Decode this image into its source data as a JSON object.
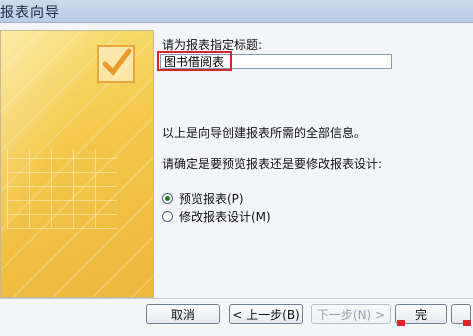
{
  "window": {
    "title": "报表向导"
  },
  "form": {
    "title_prompt": "请为报表指定标题:",
    "title_value": "图书借阅表",
    "info_text": "以上是向导创建报表所需的全部信息。",
    "question_text": "请确定是要预览报表还是要修改报表设计:",
    "options": [
      {
        "label": "预览报表(P)",
        "selected": true
      },
      {
        "label": "修改报表设计(M)",
        "selected": false
      }
    ]
  },
  "buttons": {
    "cancel": "取消",
    "back": "< 上一步(B)",
    "next": "下一步(N) >",
    "finish": "完"
  },
  "colors": {
    "highlight": "#d9262b",
    "wizard_art": "#f3c749"
  },
  "icons": {
    "wizard_art": "report-wizard-art"
  }
}
